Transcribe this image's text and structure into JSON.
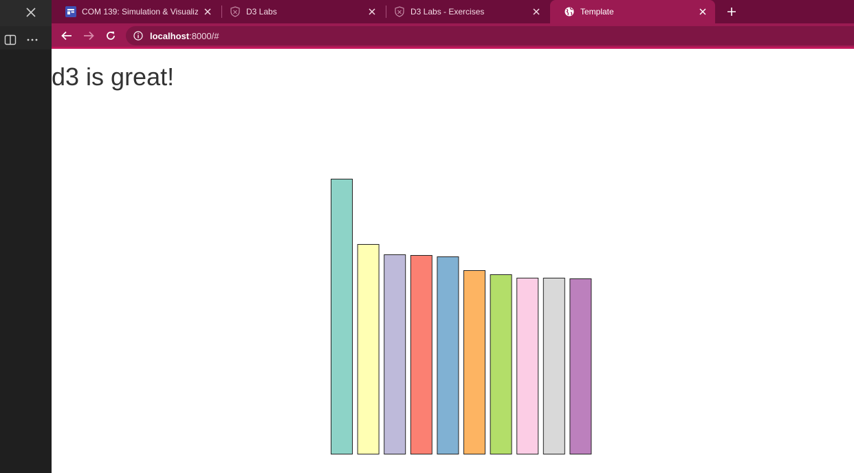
{
  "browser": {
    "tabs": [
      {
        "title": "COM 139: Simulation & Visualiza",
        "icon": "canvas-icon",
        "active": false
      },
      {
        "title": "D3 Labs",
        "icon": "shield-icon",
        "active": false
      },
      {
        "title": "D3 Labs - Exercises",
        "icon": "shield-icon",
        "active": false
      },
      {
        "title": "Template",
        "icon": "globe-icon",
        "active": true
      }
    ],
    "address": {
      "host": "localhost",
      "rest": ":8000/#"
    },
    "colors": {
      "frame": "#6b0d3a",
      "active_tab": "#9b1a52",
      "toolbar": "#9b1a52",
      "sidebar": "#1f1f1f"
    }
  },
  "page": {
    "heading": "d3 is great!"
  },
  "chart_data": {
    "type": "bar",
    "values": [
      400,
      305,
      290,
      289,
      287,
      267,
      261,
      256,
      256,
      255
    ],
    "colors": [
      "#8dd3c7",
      "#ffffb3",
      "#bebada",
      "#fb8072",
      "#80b1d3",
      "#fdb462",
      "#b3de69",
      "#fccde5",
      "#d9d9d9",
      "#bc80bd"
    ],
    "ylim": [
      0,
      400
    ],
    "axes": false,
    "grid": false
  }
}
